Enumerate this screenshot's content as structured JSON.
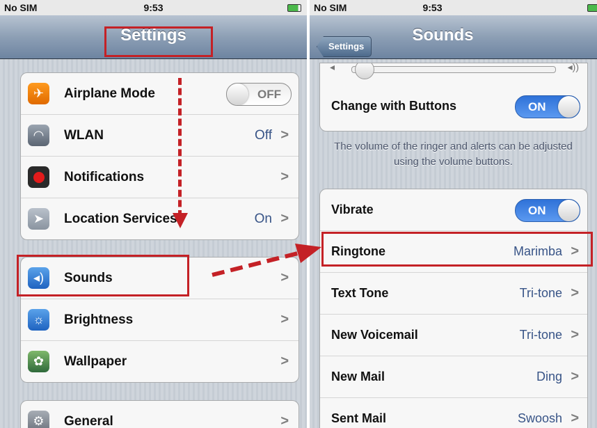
{
  "left_screen": {
    "status_bar": {
      "carrier": "No SIM",
      "time": "9:53"
    },
    "nav_title": "Settings",
    "groups": [
      [
        {
          "label": "Airplane Mode",
          "icon": "airplane-icon",
          "toggle": "OFF"
        },
        {
          "label": "WLAN",
          "icon": "wifi-icon",
          "value": "Off"
        },
        {
          "label": "Notifications",
          "icon": "notifications-icon"
        },
        {
          "label": "Location Services",
          "icon": "location-icon",
          "value": "On"
        }
      ],
      [
        {
          "label": "Sounds",
          "icon": "speaker-icon"
        },
        {
          "label": "Brightness",
          "icon": "brightness-icon"
        },
        {
          "label": "Wallpaper",
          "icon": "wallpaper-icon"
        }
      ],
      [
        {
          "label": "General",
          "icon": "gear-icon"
        }
      ]
    ]
  },
  "right_screen": {
    "status_bar": {
      "carrier": "No SIM",
      "time": "9:53"
    },
    "back_button": "Settings",
    "nav_title": "Sounds",
    "change_with_buttons": {
      "label": "Change with Buttons",
      "toggle": "ON"
    },
    "footnote": "The volume of the ringer and alerts can be adjusted using the volume buttons.",
    "rows": [
      {
        "label": "Vibrate",
        "toggle": "ON"
      },
      {
        "label": "Ringtone",
        "value": "Marimba"
      },
      {
        "label": "Text Tone",
        "value": "Tri-tone"
      },
      {
        "label": "New Voicemail",
        "value": "Tri-tone"
      },
      {
        "label": "New Mail",
        "value": "Ding"
      },
      {
        "label": "Sent Mail",
        "value": "Swoosh"
      }
    ]
  },
  "chevron": ">",
  "colors": {
    "highlight": "#c42126",
    "value_blue": "#385487",
    "toggle_on": "#2f72d8"
  }
}
